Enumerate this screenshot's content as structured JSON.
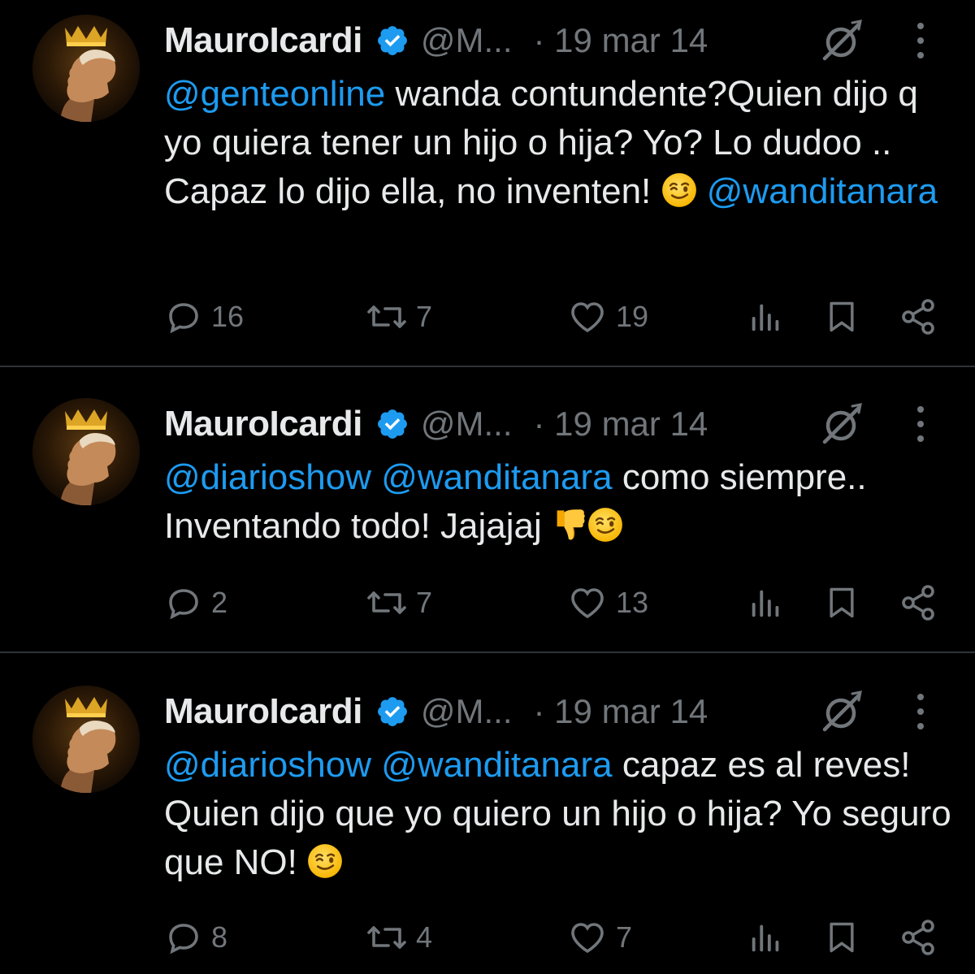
{
  "colors": {
    "background": "#000000",
    "text": "#e7e9ea",
    "muted": "#71767b",
    "mention": "#1d9bf0",
    "verified": "#1d9bf0",
    "divider": "#2f3336"
  },
  "tweets": [
    {
      "display_name": "MauroIcardi",
      "handle": "@M...",
      "date": "· 19 mar 14",
      "text_segments": [
        {
          "type": "mention",
          "text": "@genteonline"
        },
        {
          "type": "text",
          "text": " wanda contundente?Quien dijo q yo quiera tener un hijo o hija? Yo? Lo dudoo .. Capaz lo dijo ella, no inventen! "
        },
        {
          "type": "emoji",
          "name": "winking-face-emoji"
        },
        {
          "type": "text",
          "text": " "
        },
        {
          "type": "mention",
          "text": "@wanditanara"
        }
      ],
      "replies": "16",
      "retweets": "7",
      "likes": "19"
    },
    {
      "display_name": "MauroIcardi",
      "handle": "@M...",
      "date": "· 19 mar 14",
      "text_segments": [
        {
          "type": "mention",
          "text": "@diarioshow"
        },
        {
          "type": "text",
          "text": " "
        },
        {
          "type": "mention",
          "text": "@wanditanara"
        },
        {
          "type": "text",
          "text": " como siempre.. Inventando todo! Jajajaj "
        },
        {
          "type": "emoji",
          "name": "thumbs-down-emoji"
        },
        {
          "type": "emoji",
          "name": "winking-face-emoji"
        }
      ],
      "replies": "2",
      "retweets": "7",
      "likes": "13"
    },
    {
      "display_name": "MauroIcardi",
      "handle": "@M...",
      "date": "· 19 mar 14",
      "text_segments": [
        {
          "type": "mention",
          "text": "@diarioshow"
        },
        {
          "type": "text",
          "text": " "
        },
        {
          "type": "mention",
          "text": "@wanditanara"
        },
        {
          "type": "text",
          "text": " capaz es al reves! Quien dijo que yo quiero un hijo o hija? Yo seguro que NO! "
        },
        {
          "type": "emoji",
          "name": "winking-face-emoji"
        }
      ],
      "replies": "8",
      "retweets": "4",
      "likes": "7"
    }
  ],
  "icons": {
    "verified": "verified-badge-icon",
    "grok": "grok-icon",
    "more": "more-options-icon",
    "reply": "reply-icon",
    "retweet": "retweet-icon",
    "like": "heart-icon",
    "views": "views-icon",
    "bookmark": "bookmark-icon",
    "share": "share-icon"
  }
}
